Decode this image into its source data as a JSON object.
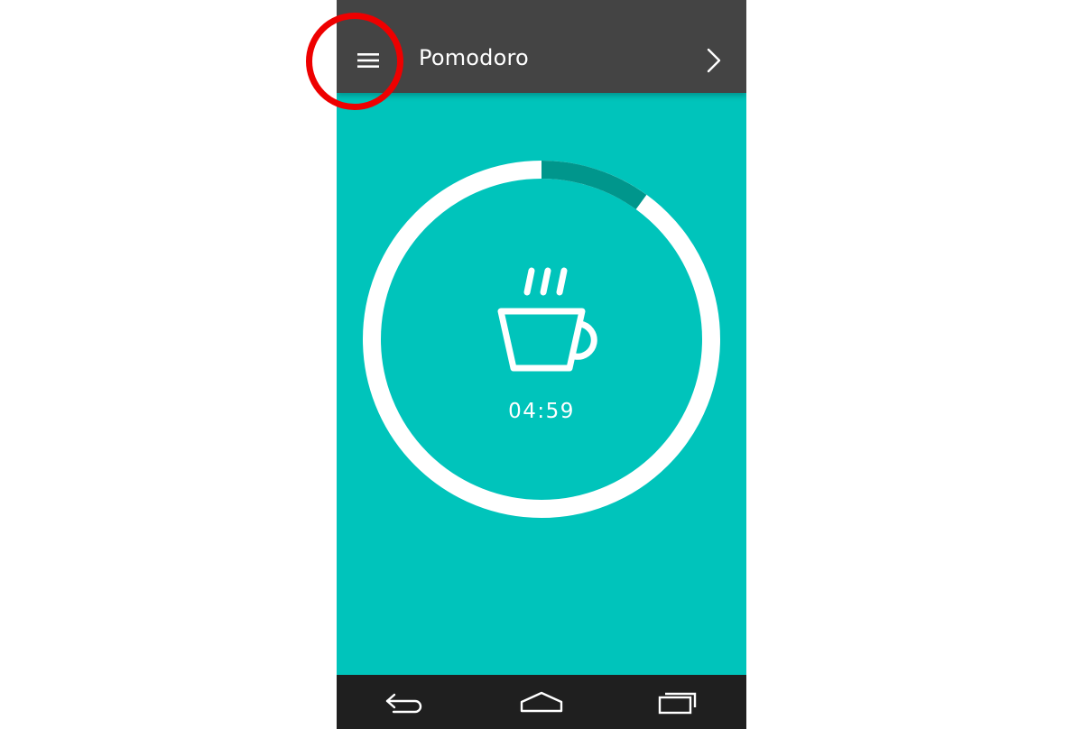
{
  "toolbar": {
    "title": "Pomodoro",
    "menu_icon": "hamburger-menu-icon",
    "next_icon": "chevron-right-icon"
  },
  "timer": {
    "time_remaining": "04:59",
    "icon": "coffee-cup-icon",
    "progress_fraction": 0.1,
    "colors": {
      "background": "#00c4bb",
      "ring": "#ffffff",
      "progress": "#00968c"
    }
  },
  "navbar": {
    "back_icon": "back-icon",
    "home_icon": "home-icon",
    "recents_icon": "recents-icon"
  },
  "annotation": {
    "highlight_color": "#ee0000"
  }
}
